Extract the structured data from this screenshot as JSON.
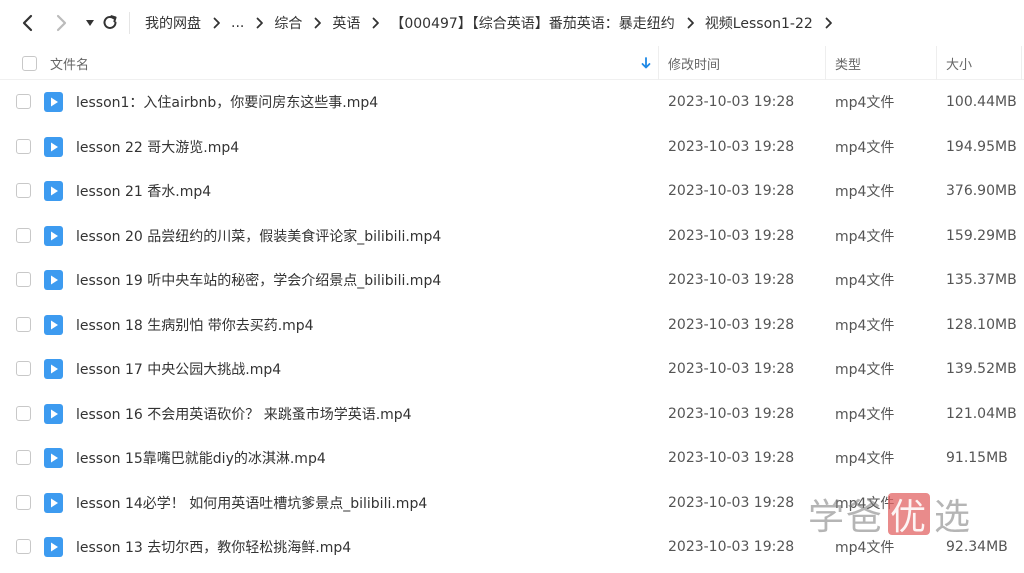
{
  "nav": {
    "back_icon": "back-arrow-icon",
    "forward_icon": "forward-arrow-icon",
    "dropdown_icon": "caret-down-icon",
    "refresh_icon": "refresh-icon"
  },
  "breadcrumb": [
    "我的网盘",
    "...",
    "综合",
    "英语",
    "【000497】【综合英语】番茄英语：暴走纽约",
    "视频Lesson1-22"
  ],
  "columns": {
    "name": "文件名",
    "modified": "修改时间",
    "type": "类型",
    "size": "大小"
  },
  "colors": {
    "accent": "#1e88e5",
    "file_icon": "#3d9bf0"
  },
  "files": [
    {
      "name": "lesson1：入住airbnb，你要问房东这些事.mp4",
      "modified": "2023-10-03 19:28",
      "type": "mp4文件",
      "size": "100.44MB"
    },
    {
      "name": "lesson 22 哥大游览.mp4",
      "modified": "2023-10-03 19:28",
      "type": "mp4文件",
      "size": "194.95MB"
    },
    {
      "name": "lesson 21 香水.mp4",
      "modified": "2023-10-03 19:28",
      "type": "mp4文件",
      "size": "376.90MB"
    },
    {
      "name": "lesson 20 品尝纽约的川菜，假装美食评论家_bilibili.mp4",
      "modified": "2023-10-03 19:28",
      "type": "mp4文件",
      "size": "159.29MB"
    },
    {
      "name": "lesson 19 听中央车站的秘密，学会介绍景点_bilibili.mp4",
      "modified": "2023-10-03 19:28",
      "type": "mp4文件",
      "size": "135.37MB"
    },
    {
      "name": "lesson 18 生病别怕 带你去买药.mp4",
      "modified": "2023-10-03 19:28",
      "type": "mp4文件",
      "size": "128.10MB"
    },
    {
      "name": "lesson 17 中央公园大挑战.mp4",
      "modified": "2023-10-03 19:28",
      "type": "mp4文件",
      "size": "139.52MB"
    },
    {
      "name": "lesson 16 不会用英语砍价？ 来跳蚤市场学英语.mp4",
      "modified": "2023-10-03 19:28",
      "type": "mp4文件",
      "size": "121.04MB"
    },
    {
      "name": "lesson 15靠嘴巴就能diy的冰淇淋.mp4",
      "modified": "2023-10-03 19:28",
      "type": "mp4文件",
      "size": "91.15MB"
    },
    {
      "name": "lesson 14必学！ 如何用英语吐槽坑爹景点_bilibili.mp4",
      "modified": "2023-10-03 19:28",
      "type": "mp4文件",
      "size": ""
    },
    {
      "name": "lesson 13 去切尔西，教你轻松挑海鲜.mp4",
      "modified": "2023-10-03 19:28",
      "type": "mp4文件",
      "size": "92.34MB"
    }
  ],
  "watermark": {
    "char1": "学",
    "char2": "爸",
    "char3": "优",
    "char4": "选"
  }
}
